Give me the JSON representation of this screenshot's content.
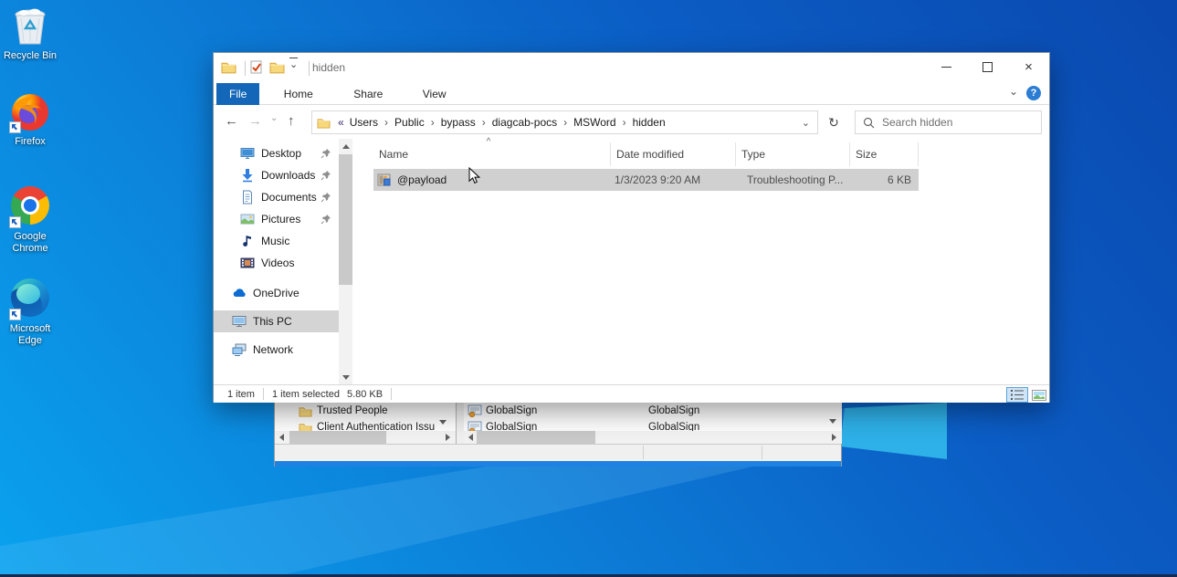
{
  "glyphs": {
    "back": "←",
    "forward": "→",
    "up": "↑",
    "dropdown": "⌄",
    "refresh": "↻",
    "overflow": "«",
    "crumb_sep": "›",
    "sort_asc": "^",
    "help": "?",
    "close": "×"
  },
  "desktop": {
    "icons": [
      {
        "label": "Recycle Bin",
        "icon": "recycle-bin-icon"
      },
      {
        "label": "Firefox",
        "icon": "firefox-icon"
      },
      {
        "label": "Google Chrome",
        "icon": "chrome-icon"
      },
      {
        "label": "Microsoft Edge",
        "icon": "edge-icon"
      }
    ]
  },
  "explorer": {
    "title": "hidden",
    "ribbon": {
      "tabs": [
        "File",
        "Home",
        "Share",
        "View"
      ]
    },
    "nav": {
      "crumbs": [
        "Users",
        "Public",
        "bypass",
        "diagcab-pocs",
        "MSWord",
        "hidden"
      ]
    },
    "search": {
      "placeholder": "Search hidden"
    },
    "sidebar": {
      "items": [
        {
          "label": "Desktop",
          "icon": "desktop-icon",
          "pinned": true
        },
        {
          "label": "Downloads",
          "icon": "downloads-icon",
          "pinned": true
        },
        {
          "label": "Documents",
          "icon": "documents-icon",
          "pinned": true
        },
        {
          "label": "Pictures",
          "icon": "pictures-icon",
          "pinned": true
        },
        {
          "label": "Music",
          "icon": "music-icon",
          "pinned": false
        },
        {
          "label": "Videos",
          "icon": "videos-icon",
          "pinned": false
        },
        {
          "label": "OneDrive",
          "icon": "onedrive-icon",
          "pinned": false
        },
        {
          "label": "This PC",
          "icon": "this-pc-icon",
          "pinned": false,
          "selected": true
        },
        {
          "label": "Network",
          "icon": "network-icon",
          "pinned": false
        }
      ]
    },
    "list": {
      "columns": [
        "Name",
        "Date modified",
        "Type",
        "Size"
      ],
      "rows": [
        {
          "name": "@payload",
          "date_modified": "1/3/2023 9:20 AM",
          "type": "Troubleshooting P...",
          "size": "6 KB",
          "selected": true
        }
      ]
    },
    "status": {
      "item_count": "1 item",
      "selected": "1 item selected",
      "selected_size": "5.80 KB"
    }
  },
  "cert_window": {
    "tree_items": [
      "Trusted People",
      "Client Authentication Issu"
    ],
    "rows": [
      {
        "issued_to": "GlobalSign",
        "issued_by": "GlobalSign"
      },
      {
        "issued_to": "GlobalSign",
        "issued_by": "GlobalSign"
      }
    ]
  },
  "colors": {
    "accent": "#1467b8",
    "selection_gray": "#d0d0d0",
    "wallpaper_pane": "#2eb0e8",
    "taskbar": "#16294e",
    "cert_border_blue": "#1e82e2"
  }
}
